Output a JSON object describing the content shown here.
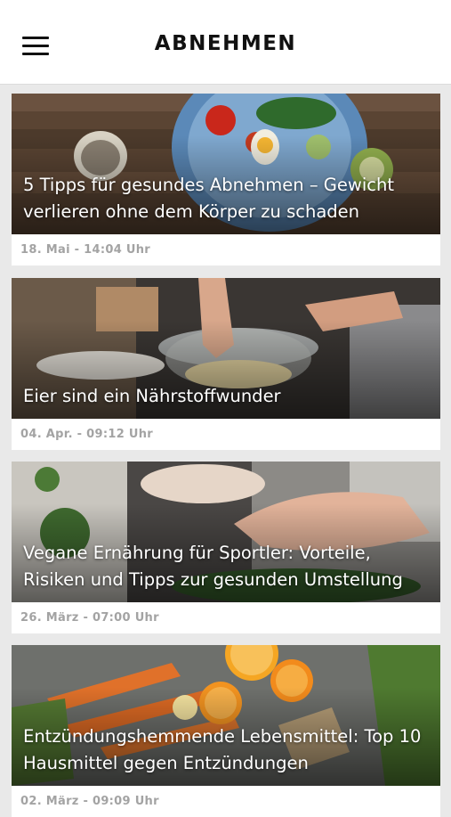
{
  "header": {
    "title": "ABNEHMEN",
    "menu_icon": "hamburger-menu-icon"
  },
  "articles": [
    {
      "headline": "5 Tipps für gesundes Abnehmen – Gewicht verlieren ohne dem Körper zu schaden",
      "date": "18. Mai - 14:04 Uhr"
    },
    {
      "headline": "Eier sind ein Nährstoffwunder",
      "date": "04. Apr. - 09:12 Uhr"
    },
    {
      "headline": "Vegane Ernährung für Sportler: Vorteile, Risiken und Tipps zur gesunden Umstellung",
      "date": "26. März - 07:00 Uhr"
    },
    {
      "headline": "Entzündungshemmende Lebensmittel: Top 10 Hausmittel gegen Entzündungen",
      "date": "02. März - 09:09 Uhr"
    }
  ]
}
